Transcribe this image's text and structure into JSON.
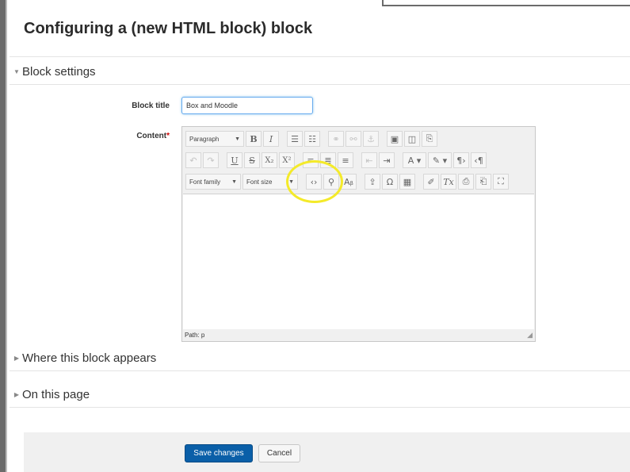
{
  "page": {
    "title": "Configuring a (new HTML block) block"
  },
  "sections": {
    "block_settings": "Block settings",
    "where_appears": "Where this block appears",
    "on_this_page": "On this page"
  },
  "form": {
    "block_title_label": "Block title",
    "block_title_value": "Box and Moodle",
    "content_label": "Content",
    "required_mark": "*"
  },
  "editor": {
    "paragraph_dropdown": "Paragraph",
    "font_family_dropdown": "Font family",
    "font_size_dropdown": "Font size",
    "path": "Path: p",
    "icons": [
      "paragraph-format-dropdown",
      "bold-icon",
      "italic-icon",
      "unordered-list-icon",
      "ordered-list-icon",
      "link-icon",
      "unlink-icon",
      "anchor-icon",
      "image-icon",
      "media-icon",
      "manage-files-icon",
      "undo-icon",
      "redo-icon",
      "underline-icon",
      "strikethrough-icon",
      "subscript-icon",
      "superscript-icon",
      "align-left-icon",
      "align-center-icon",
      "align-right-icon",
      "outdent-icon",
      "indent-icon",
      "text-color-icon",
      "background-color-icon",
      "ltr-icon",
      "rtl-icon",
      "html-source-icon",
      "find-replace-icon",
      "spellcheck-icon",
      "upload-icon",
      "special-char-icon",
      "table-icon",
      "clean-icon",
      "clear-format-icon",
      "paste-text-icon",
      "paste-word-icon",
      "fullscreen-icon"
    ]
  },
  "buttons": {
    "save": "Save changes",
    "cancel": "Cancel"
  }
}
